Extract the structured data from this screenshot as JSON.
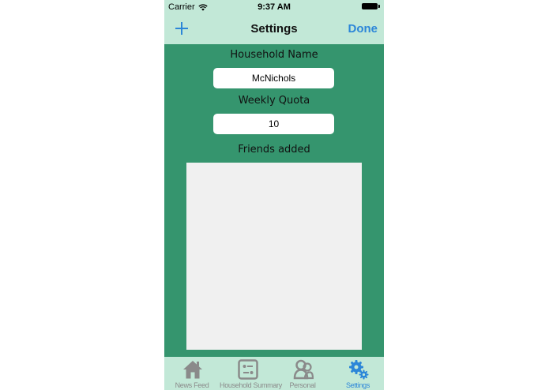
{
  "status_bar": {
    "carrier": "Carrier",
    "time": "9:37 AM"
  },
  "nav": {
    "title": "Settings",
    "done_label": "Done",
    "add_icon": "plus-icon"
  },
  "form": {
    "household_name_label": "Household Name",
    "household_name_value": "McNichols",
    "weekly_quota_label": "Weekly Quota",
    "weekly_quota_value": "10",
    "friends_label": "Friends added",
    "friends": []
  },
  "tabs": [
    {
      "label": "News Feed",
      "icon": "house-icon",
      "active": false
    },
    {
      "label": "Household Summary",
      "icon": "summary-icon",
      "active": false
    },
    {
      "label": "Personal",
      "icon": "people-icon",
      "active": false
    },
    {
      "label": "Settings",
      "icon": "gears-icon",
      "active": true
    }
  ],
  "colors": {
    "background": "#35956e",
    "bars": "#c2e8d7",
    "accent": "#2c86d8",
    "inactive_tab": "#8a8a8a"
  }
}
